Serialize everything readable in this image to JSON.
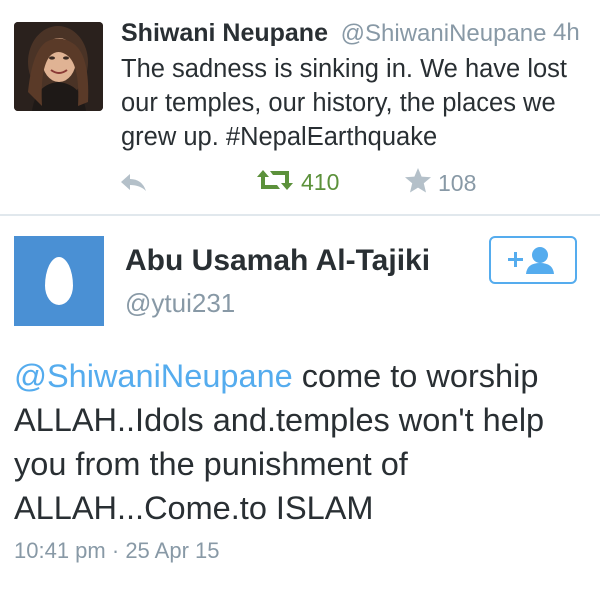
{
  "tweet1": {
    "name": "Shiwani Neupane",
    "handle": "@ShiwaniNeupane",
    "time": "4h",
    "text": "The sadness is sinking in. We have lost our temples, our history, the places we grew up. #NepalEarthquake",
    "retweets": "410",
    "favorites": "108"
  },
  "tweet2": {
    "name": "Abu Usamah Al-Tajiki",
    "handle": "@ytui231",
    "mention": "@ShiwaniNeupane",
    "text": " come to worship ALLAH..Idols and.temples won't help you from the punishment of ALLAH...Come.to ISLAM",
    "time": "10:41 pm",
    "separator": "·",
    "date": "25 Apr 15"
  },
  "colors": {
    "brand_blue": "#55acee",
    "retweet_green": "#5c913b",
    "muted_gray": "#8899a6",
    "text_dark": "#292f33",
    "egg_avatar_bg": "#4a90d4"
  },
  "icons": {
    "reply": "reply-arrow-icon",
    "retweet": "retweet-icon",
    "favorite": "star-icon",
    "follow": "add-user-icon"
  }
}
